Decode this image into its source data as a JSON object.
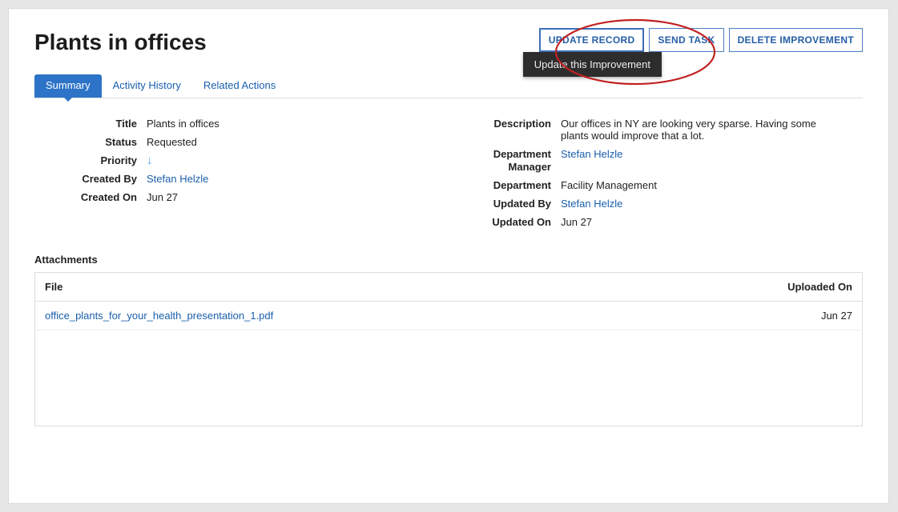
{
  "page_title": "Plants in offices",
  "actions": {
    "update_label": "UPDATE RECORD",
    "send_label": "SEND TASK",
    "delete_label": "DELETE IMPROVEMENT",
    "update_tooltip": "Update this Improvement"
  },
  "tabs": {
    "summary": "Summary",
    "history": "Activity History",
    "related": "Related Actions"
  },
  "left": {
    "title_label": "Title",
    "title_value": "Plants in offices",
    "status_label": "Status",
    "status_value": "Requested",
    "priority_label": "Priority",
    "created_by_label": "Created By",
    "created_by_value": "Stefan Helzle",
    "created_on_label": "Created On",
    "created_on_value": "Jun 27"
  },
  "right": {
    "description_label": "Description",
    "description_value": "Our offices in NY are looking very sparse. Having some plants would improve that a lot.",
    "dept_mgr_label": "Department Manager",
    "dept_mgr_value": "Stefan Helzle",
    "dept_label": "Department",
    "dept_value": "Facility Management",
    "updated_by_label": "Updated By",
    "updated_by_value": "Stefan Helzle",
    "updated_on_label": "Updated On",
    "updated_on_value": "Jun 27"
  },
  "attachments": {
    "section_label": "Attachments",
    "col_file": "File",
    "col_uploaded": "Uploaded On",
    "rows": [
      {
        "file": "office_plants_for_your_health_presentation_1.pdf",
        "uploaded": "Jun 27"
      }
    ]
  }
}
